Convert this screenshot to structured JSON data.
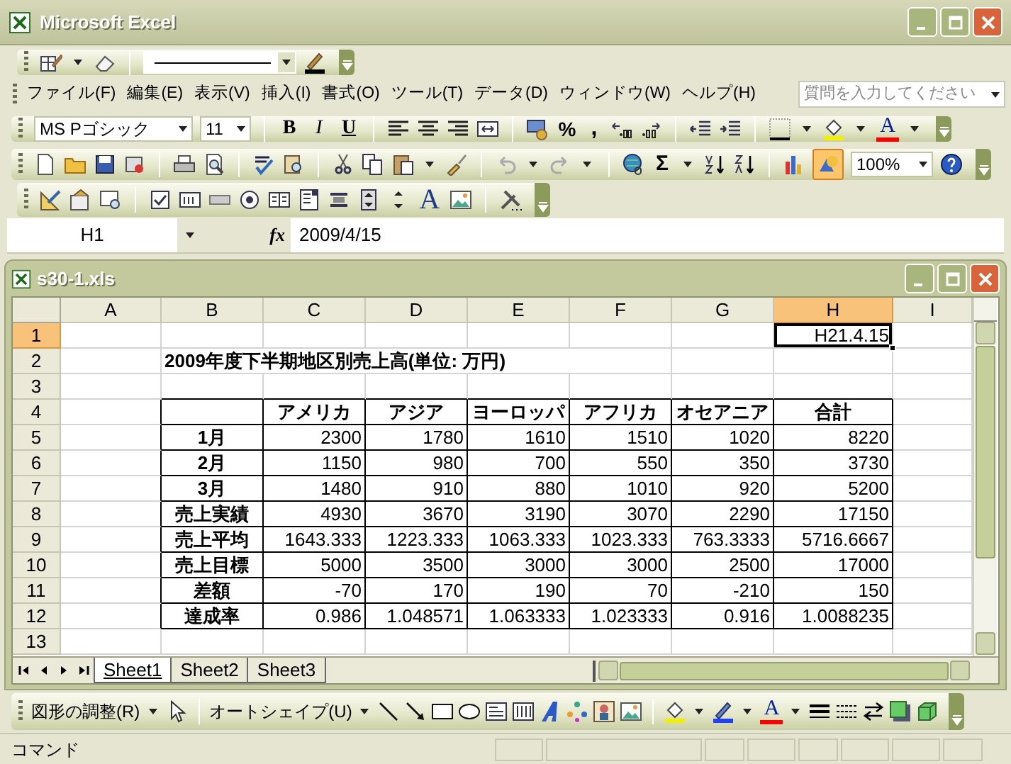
{
  "window": {
    "title": "Microsoft Excel"
  },
  "menu": [
    {
      "label": "ファイル(F)"
    },
    {
      "label": "編集(E)"
    },
    {
      "label": "表示(V)"
    },
    {
      "label": "挿入(I)"
    },
    {
      "label": "書式(O)"
    },
    {
      "label": "ツール(T)"
    },
    {
      "label": "データ(D)"
    },
    {
      "label": "ウィンドウ(W)"
    },
    {
      "label": "ヘルプ(H)"
    }
  ],
  "help_search": {
    "placeholder": "質問を入力してください"
  },
  "formatting": {
    "font": "MS Pゴシック",
    "size": "11",
    "bold": "B",
    "italic": "I",
    "underline": "U",
    "percent": "%",
    "comma": ",",
    "font_color": "A"
  },
  "standard": {
    "sum": "Σ",
    "zoom": "100%",
    "undo": {
      "disabled": true
    },
    "redo": {
      "disabled": true
    },
    "drawing": {
      "on": true
    }
  },
  "forms": {
    "label_tool": "A"
  },
  "formula_bar": {
    "name_box": "H1",
    "function_label": "fx",
    "value": "2009/4/15"
  },
  "workbook": {
    "title": "s30-1.xls",
    "columns": [
      {
        "label": "A",
        "selected": false
      },
      {
        "label": "B",
        "selected": false
      },
      {
        "label": "C",
        "selected": false
      },
      {
        "label": "D",
        "selected": false
      },
      {
        "label": "E",
        "selected": false
      },
      {
        "label": "F",
        "selected": false
      },
      {
        "label": "G",
        "selected": false
      },
      {
        "label": "H",
        "selected": true
      },
      {
        "label": "I",
        "selected": false
      }
    ],
    "rows": [
      {
        "header": "1",
        "selected": true,
        "boxed": false,
        "cells": {
          "H": {
            "kind": "number",
            "text": "H21.4.15"
          }
        }
      },
      {
        "header": "2",
        "selected": false,
        "boxed": false,
        "cells": {
          "B": {
            "kind": "title",
            "text": "2009年度下半期地区別売上高(単位: 万円)"
          }
        }
      },
      {
        "header": "3",
        "selected": false,
        "boxed": false
      },
      {
        "header": "4",
        "selected": false,
        "boxed": true,
        "cells": {
          "C": {
            "kind": "heading",
            "text": "アメリカ"
          },
          "D": {
            "kind": "heading",
            "text": "アジア"
          },
          "E": {
            "kind": "heading",
            "text": "ヨーロッパ"
          },
          "F": {
            "kind": "heading",
            "text": "アフリカ"
          },
          "G": {
            "kind": "heading",
            "text": "オセアニア"
          },
          "H": {
            "kind": "heading",
            "text": "合計"
          }
        }
      },
      {
        "header": "5",
        "selected": false,
        "boxed": true,
        "cells": {
          "B": {
            "kind": "label",
            "text": "1月"
          },
          "C": {
            "kind": "number",
            "text": "2300"
          },
          "D": {
            "kind": "number",
            "text": "1780"
          },
          "E": {
            "kind": "number",
            "text": "1610"
          },
          "F": {
            "kind": "number",
            "text": "1510"
          },
          "G": {
            "kind": "number",
            "text": "1020"
          },
          "H": {
            "kind": "number",
            "text": "8220"
          }
        }
      },
      {
        "header": "6",
        "selected": false,
        "boxed": true,
        "cells": {
          "B": {
            "kind": "label",
            "text": "2月"
          },
          "C": {
            "kind": "number",
            "text": "1150"
          },
          "D": {
            "kind": "number",
            "text": "980"
          },
          "E": {
            "kind": "number",
            "text": "700"
          },
          "F": {
            "kind": "number",
            "text": "550"
          },
          "G": {
            "kind": "number",
            "text": "350"
          },
          "H": {
            "kind": "number",
            "text": "3730"
          }
        }
      },
      {
        "header": "7",
        "selected": false,
        "boxed": true,
        "cells": {
          "B": {
            "kind": "label",
            "text": "3月"
          },
          "C": {
            "kind": "number",
            "text": "1480"
          },
          "D": {
            "kind": "number",
            "text": "910"
          },
          "E": {
            "kind": "number",
            "text": "880"
          },
          "F": {
            "kind": "number",
            "text": "1010"
          },
          "G": {
            "kind": "number",
            "text": "920"
          },
          "H": {
            "kind": "number",
            "text": "5200"
          }
        }
      },
      {
        "header": "8",
        "selected": false,
        "boxed": true,
        "cells": {
          "B": {
            "kind": "label",
            "text": "売上実績"
          },
          "C": {
            "kind": "number",
            "text": "4930"
          },
          "D": {
            "kind": "number",
            "text": "3670"
          },
          "E": {
            "kind": "number",
            "text": "3190"
          },
          "F": {
            "kind": "number",
            "text": "3070"
          },
          "G": {
            "kind": "number",
            "text": "2290"
          },
          "H": {
            "kind": "number",
            "text": "17150"
          }
        }
      },
      {
        "header": "9",
        "selected": false,
        "boxed": true,
        "cells": {
          "B": {
            "kind": "label",
            "text": "売上平均"
          },
          "C": {
            "kind": "number",
            "text": "1643.333"
          },
          "D": {
            "kind": "number",
            "text": "1223.333"
          },
          "E": {
            "kind": "number",
            "text": "1063.333"
          },
          "F": {
            "kind": "number",
            "text": "1023.333"
          },
          "G": {
            "kind": "number",
            "text": "763.3333"
          },
          "H": {
            "kind": "number",
            "text": "5716.6667"
          }
        }
      },
      {
        "header": "10",
        "selected": false,
        "boxed": true,
        "cells": {
          "B": {
            "kind": "label",
            "text": "売上目標"
          },
          "C": {
            "kind": "number",
            "text": "5000"
          },
          "D": {
            "kind": "number",
            "text": "3500"
          },
          "E": {
            "kind": "number",
            "text": "3000"
          },
          "F": {
            "kind": "number",
            "text": "3000"
          },
          "G": {
            "kind": "number",
            "text": "2500"
          },
          "H": {
            "kind": "number",
            "text": "17000"
          }
        }
      },
      {
        "header": "11",
        "selected": false,
        "boxed": true,
        "cells": {
          "B": {
            "kind": "label",
            "text": "差額"
          },
          "C": {
            "kind": "number",
            "text": "-70"
          },
          "D": {
            "kind": "number",
            "text": "170"
          },
          "E": {
            "kind": "number",
            "text": "190"
          },
          "F": {
            "kind": "number",
            "text": "70"
          },
          "G": {
            "kind": "number",
            "text": "-210"
          },
          "H": {
            "kind": "number",
            "text": "150"
          }
        }
      },
      {
        "header": "12",
        "selected": false,
        "boxed": true,
        "cells": {
          "B": {
            "kind": "label",
            "text": "達成率"
          },
          "C": {
            "kind": "number",
            "text": "0.986"
          },
          "D": {
            "kind": "number",
            "text": "1.048571"
          },
          "E": {
            "kind": "number",
            "text": "1.063333"
          },
          "F": {
            "kind": "number",
            "text": "1.023333"
          },
          "G": {
            "kind": "number",
            "text": "0.916"
          },
          "H": {
            "kind": "number",
            "text": "1.0088235"
          }
        }
      },
      {
        "header": "13",
        "selected": false,
        "boxed": false
      }
    ],
    "sheets": [
      {
        "label": "Sheet1",
        "selected": true
      },
      {
        "label": "Sheet2",
        "selected": false
      },
      {
        "label": "Sheet3",
        "selected": false
      }
    ]
  },
  "drawing_toolbar": {
    "draw_menu": "図形の調整(R)",
    "autoshapes": "オートシェイプ(U)",
    "font_color": "A"
  },
  "status_bar": {
    "text": "コマンド"
  }
}
